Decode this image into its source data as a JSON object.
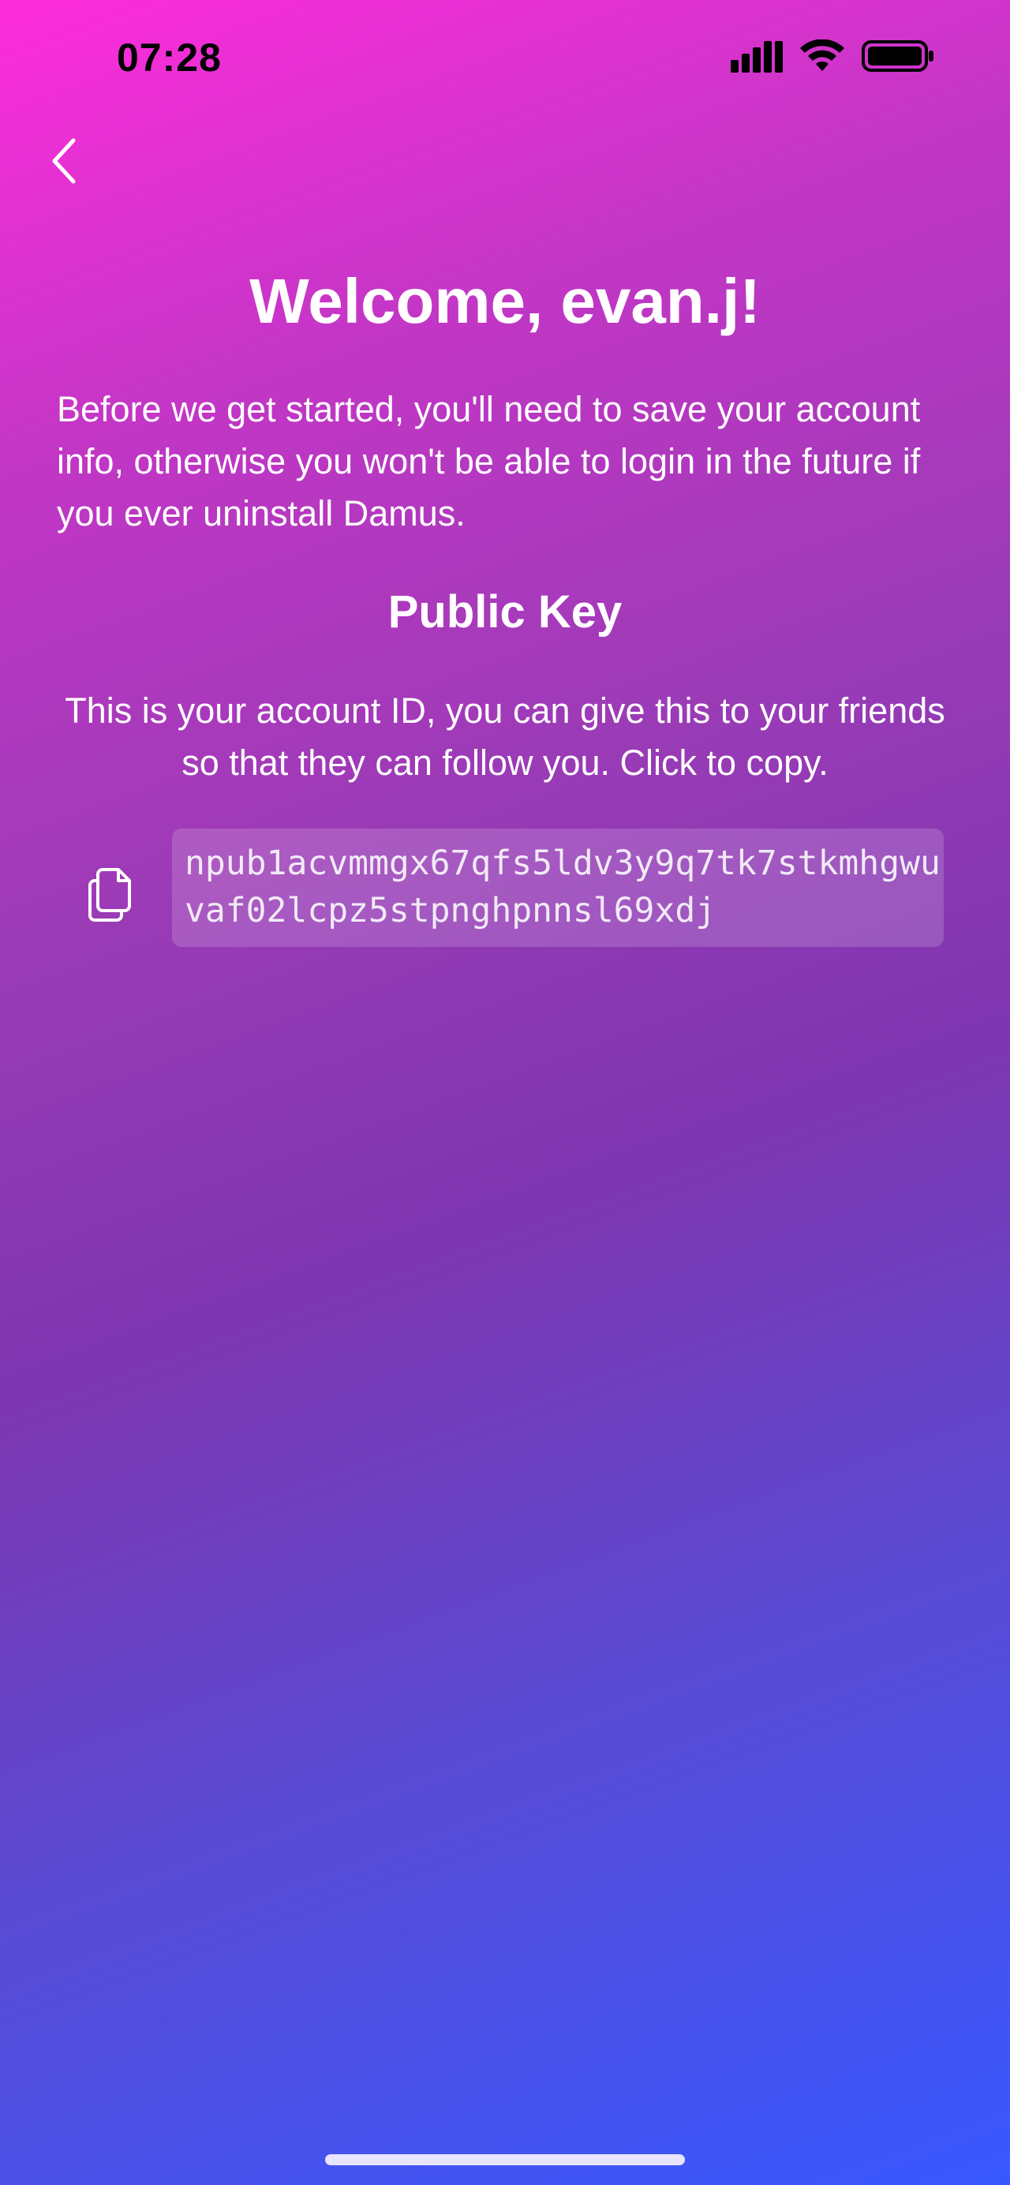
{
  "status_bar": {
    "time": "07:28",
    "icons": [
      "cellular-signal-icon",
      "wifi-icon",
      "battery-icon"
    ]
  },
  "nav": {
    "back_icon": "chevron-left-icon"
  },
  "welcome": {
    "title": "Welcome, evan.j!",
    "intro": "Before we get started, you'll need to save your account info, otherwise you won't be able to login in the future if you ever uninstall Damus."
  },
  "public_key": {
    "heading": "Public Key",
    "description": "This is your account ID, you can give this to your friends so that they can follow you. Click to copy.",
    "copy_icon": "copy-icon",
    "value": "npub1acvmmgx67qfs5ldv3y9q7tk7stkmhgwuvaf02lcpz5stpnghpnnsl69xdj"
  },
  "colors": {
    "gradient_top": "#ff2cdc",
    "gradient_mid": "#7d36b0",
    "gradient_bottom": "#3858ff",
    "text": "#ffffff"
  }
}
